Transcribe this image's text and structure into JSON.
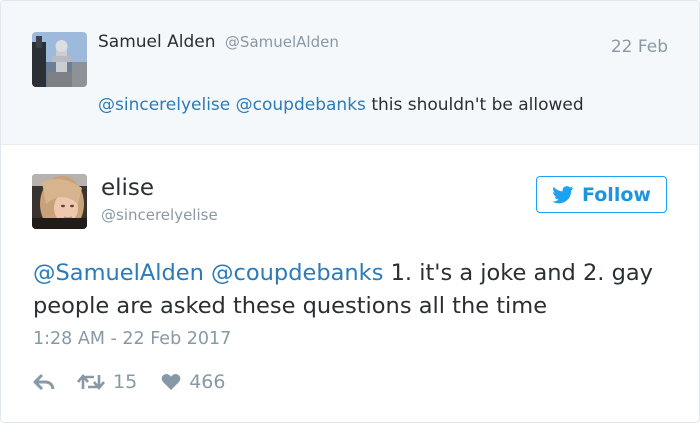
{
  "parent_tweet": {
    "name": "Samuel Alden",
    "handle": "@SamuelAlden",
    "date": "22 Feb",
    "mentions": [
      "@sincerelyelise",
      "@coupdebanks"
    ],
    "text": "this shouldn't be allowed"
  },
  "main_tweet": {
    "name": "elise",
    "handle": "@sincerelyelise",
    "follow_label": "Follow",
    "mentions": [
      "@SamuelAlden",
      "@coupdebanks"
    ],
    "text": "1. it's a joke and 2. gay people are asked these questions all the time",
    "timestamp": "1:28 AM - 22 Feb 2017",
    "retweet_count": "15",
    "like_count": "466"
  },
  "icons": {
    "follow": "twitter-bird-icon",
    "reply": "reply-arrow-icon",
    "retweet": "retweet-icon",
    "like": "heart-icon"
  },
  "colors": {
    "link": "#2b7bb9",
    "twitter_blue": "#1da1f2",
    "muted": "#8899a6",
    "text": "#292f33",
    "parent_bg": "#f5f8fa"
  }
}
